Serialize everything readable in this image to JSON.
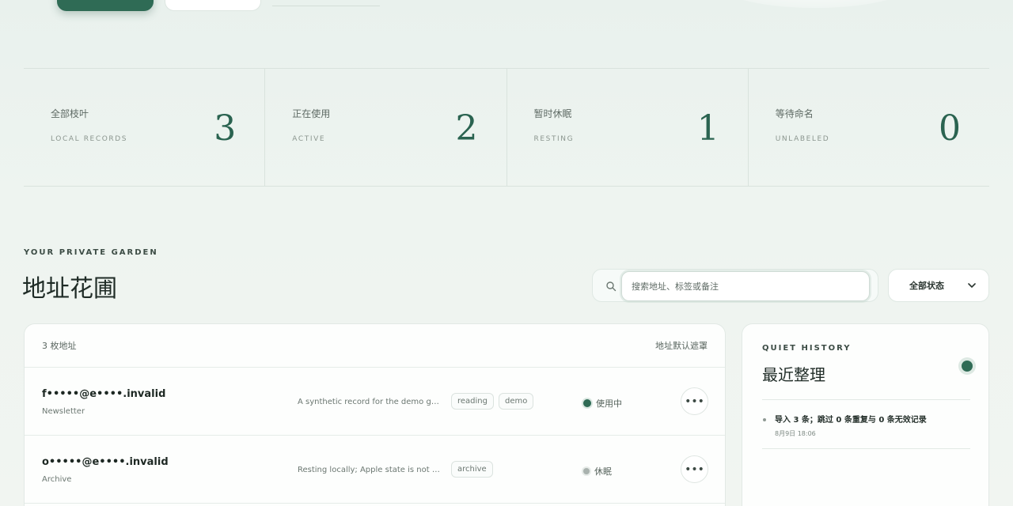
{
  "header": {
    "primary_label": "",
    "secondary_label": ""
  },
  "stats": [
    {
      "label": "全部枝叶",
      "sub": "LOCAL RECORDS",
      "value": "3"
    },
    {
      "label": "正在使用",
      "sub": "ACTIVE",
      "value": "2"
    },
    {
      "label": "暂时休眠",
      "sub": "RESTING",
      "value": "1"
    },
    {
      "label": "等待命名",
      "sub": "UNLABELED",
      "value": "0"
    }
  ],
  "section": {
    "eyebrow": "YOUR PRIVATE GARDEN",
    "title": "地址花圃"
  },
  "search": {
    "placeholder": "搜索地址、标签或备注",
    "value": ""
  },
  "filter": {
    "selected": "全部状态"
  },
  "list": {
    "count": "3 枚地址",
    "mask_label": "地址默认遮罩",
    "rows": [
      {
        "email": "f•••••@e••••.invalid",
        "tagline": "Newsletter",
        "note": "A synthetic record for the demo garden",
        "tags": [
          "reading",
          "demo"
        ],
        "status": "使用中",
        "status_type": "active"
      },
      {
        "email": "o•••••@e••••.invalid",
        "tagline": "Archive",
        "note": "Resting locally; Apple state is not checked",
        "tags": [
          "archive"
        ],
        "status": "休眠",
        "status_type": "rest"
      }
    ]
  },
  "history": {
    "eyebrow": "QUIET HISTORY",
    "title": "最近整理",
    "entry": "导入 3 条；跳过 0 条重复与 0 条无效记录",
    "time": "8月9日 18:06"
  },
  "colors": {
    "accent": "#2f6b55",
    "background": "#eef4f0"
  }
}
